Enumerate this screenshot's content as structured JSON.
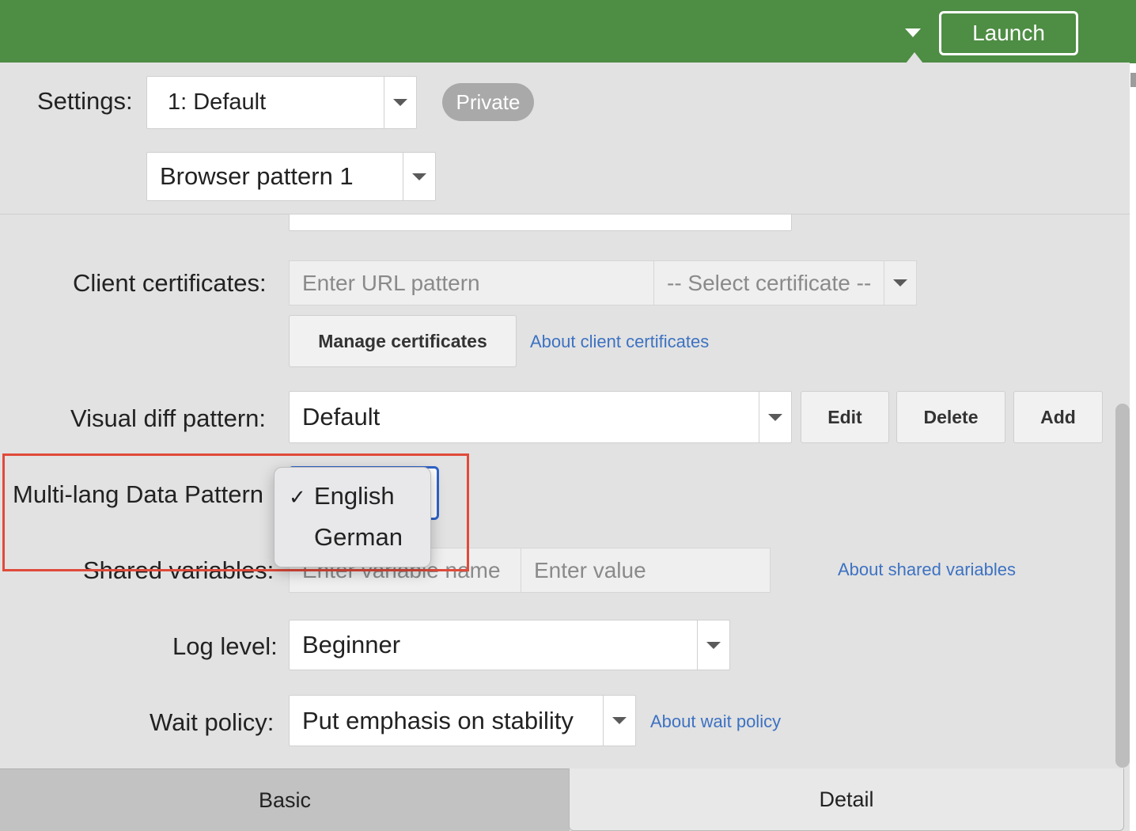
{
  "topbar": {
    "launch_label": "Launch",
    "dropdown_icon": "caret-down-icon"
  },
  "header": {
    "settings_label": "Settings:",
    "settings_value": "1: Default",
    "badge": "Private",
    "browser_pattern_value": "Browser pattern 1"
  },
  "form": {
    "client_certificates": {
      "label": "Client certificates:",
      "url_placeholder": "Enter URL pattern",
      "certificate_placeholder": "-- Select certificate --",
      "manage_button": "Manage certificates",
      "about_link": "About client certificates"
    },
    "visual_diff": {
      "label": "Visual diff pattern:",
      "value": "Default",
      "edit_button": "Edit",
      "delete_button": "Delete",
      "add_button": "Add"
    },
    "multilang": {
      "label": "Multi-lang Data Pattern",
      "options": [
        "English",
        "German"
      ],
      "selected": "English"
    },
    "shared_variables": {
      "label": "Shared variables:",
      "name_placeholder": "Enter variable name",
      "value_placeholder": "Enter value",
      "about_link": "About shared variables"
    },
    "log_level": {
      "label": "Log level:",
      "value": "Beginner"
    },
    "wait_policy": {
      "label": "Wait policy:",
      "value": "Put emphasis on stability",
      "about_link": "About wait policy"
    }
  },
  "tabs": [
    {
      "label": "Basic"
    },
    {
      "label": "Detail"
    }
  ],
  "colors": {
    "topbar": "#4e8d44",
    "link": "#3d72c2",
    "highlight": "#e04a3a"
  }
}
